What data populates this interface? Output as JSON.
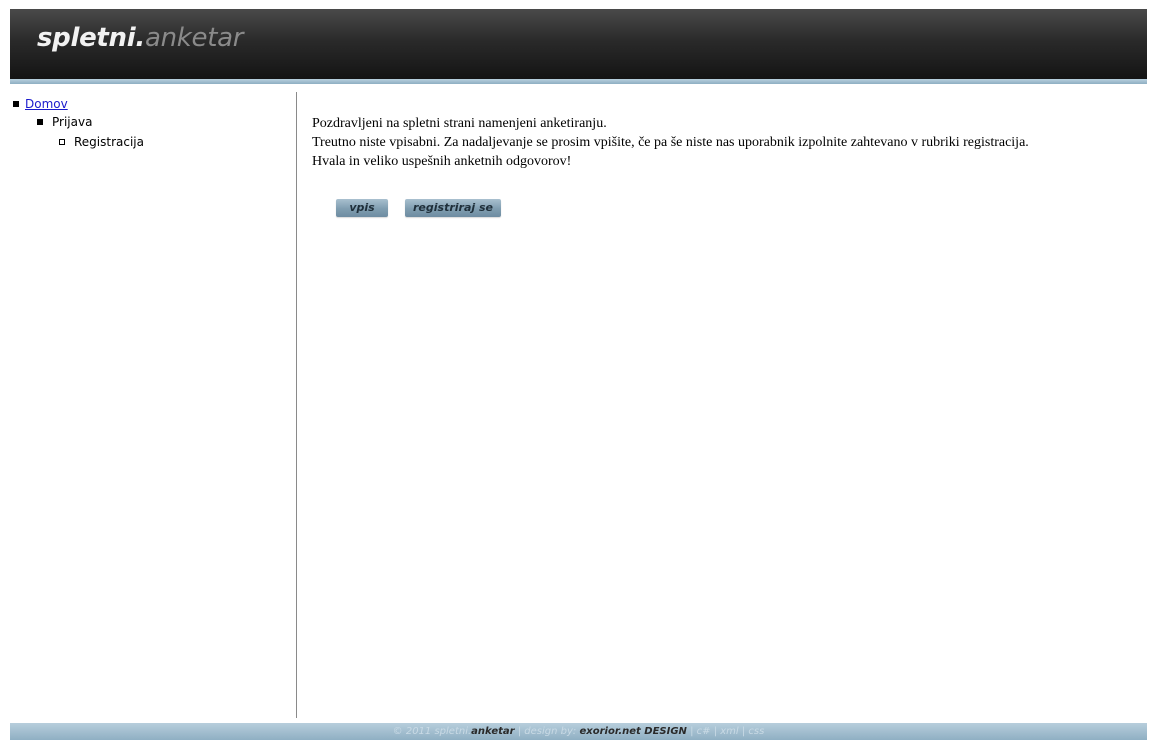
{
  "header": {
    "logo_part1": "spletni.",
    "logo_part2": "anketar"
  },
  "sidebar": {
    "items": [
      {
        "label": "Domov",
        "level": 0,
        "bullet": "filled-square",
        "link": true
      },
      {
        "label": "Prijava",
        "level": 1,
        "bullet": "filled-square",
        "link": false
      },
      {
        "label": "Registracija",
        "level": 2,
        "bullet": "hollow-square",
        "link": false
      }
    ]
  },
  "main": {
    "line1": "Pozdravljeni na spletni strani namenjeni anketiranju.",
    "line2": "Treutno niste vpisabni. Za nadaljevanje se prosim vpišite, če pa še niste nas uporabnik izpolnite zahtevano v rubriki registracija.",
    "line3": "Hvala in veliko uspešnih anketnih odgovorov!",
    "buttons": {
      "login": "vpis",
      "register": "registriraj se"
    }
  },
  "footer": {
    "copyright": "© 2011 spletni.",
    "brand": "anketar",
    "design_by": " | design by: ",
    "designer": "exorior.net DESIGN",
    "tech": " | c# | xml | css"
  },
  "colors": {
    "header_bg": "#1e1e1e",
    "accent": "#8fafc3",
    "link": "#1a1acc"
  }
}
